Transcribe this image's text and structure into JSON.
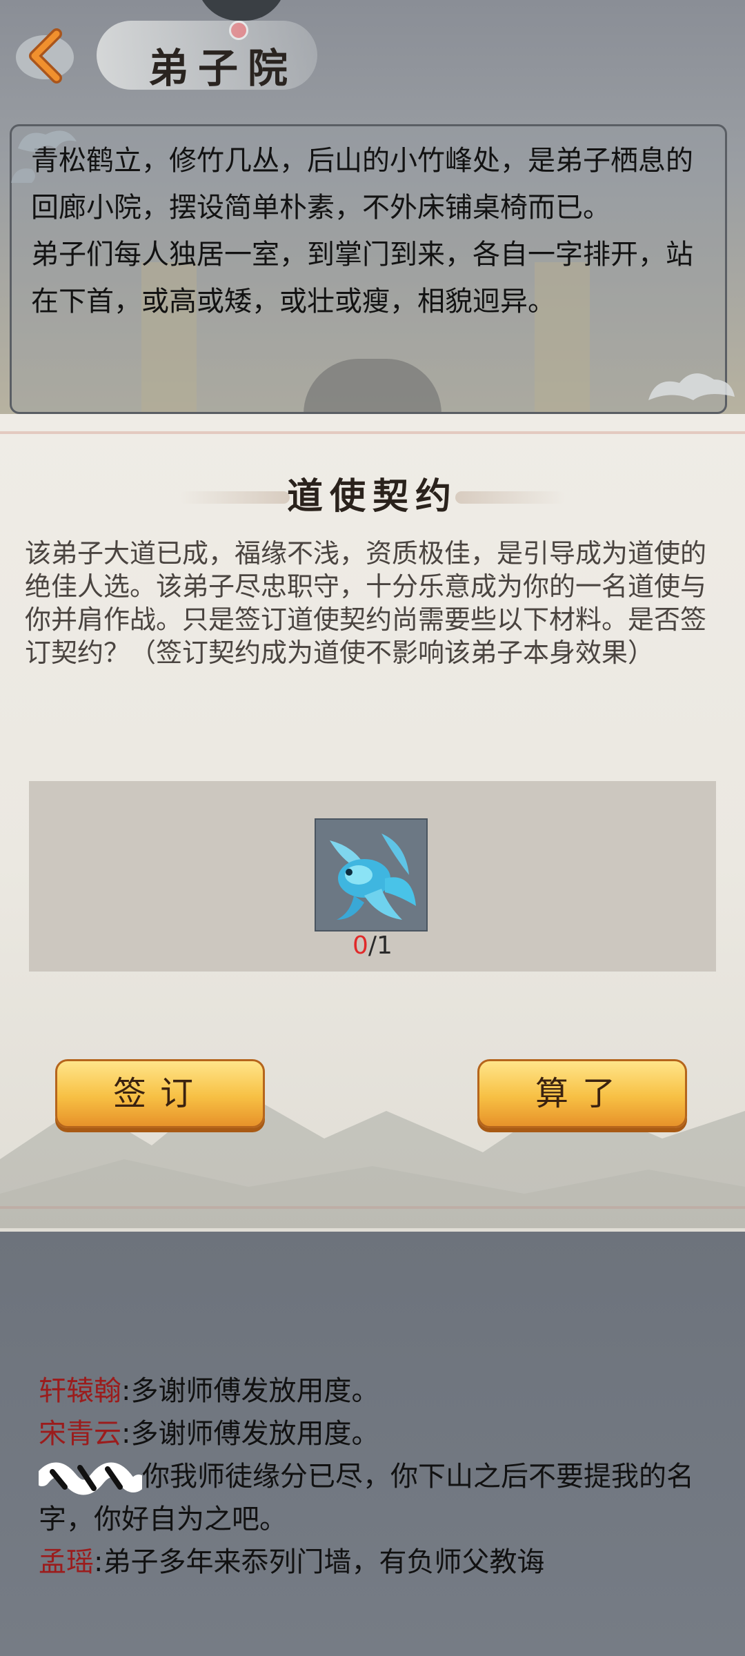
{
  "header": {
    "title": "弟子院"
  },
  "description": {
    "paragraphs": [
      "青松鹤立，修竹几丛，后山的小竹峰处，是弟子栖息的回廊小院，摆设简单朴素，不外床铺桌椅而已。",
      "弟子们每人独居一室，到掌门到来，各自一字排开，站在下首，或高或矮，或壮或瘦，相貌迥异。"
    ]
  },
  "dialog": {
    "title": "道使契约",
    "body": "该弟子大道已成，福缘不浅，资质极佳，是引导成为道使的绝佳人选。该弟子尽忠职守，十分乐意成为你的一名道使与你并肩作战。只是签订道使契约尚需要些以下材料。是否签订契约？（签订契约成为道使不影响该弟子本身效果）",
    "material": {
      "icon": "blue-fish-icon",
      "have": "0",
      "need": "/1"
    },
    "buttons": {
      "sign": "签订",
      "cancel": "算了"
    }
  },
  "chat": [
    {
      "name": "轩辕翰",
      "sep": ":",
      "text": "多谢师傅发放用度。"
    },
    {
      "name": "宋青云",
      "sep": ":",
      "text": "多谢师傅发放用度。"
    },
    {
      "name": "",
      "sep": "",
      "text": "你我师徒缘分已尽，你下山之后不要提我的名字，你好自为之吧。"
    },
    {
      "name": "孟瑶",
      "sep": ":",
      "text": "弟子多年来忝列门墙，有负师父教诲"
    }
  ],
  "colors": {
    "accent_name": "#9b1c1c",
    "count_have": "#e02a2a",
    "button_gold": "#f7c044"
  }
}
